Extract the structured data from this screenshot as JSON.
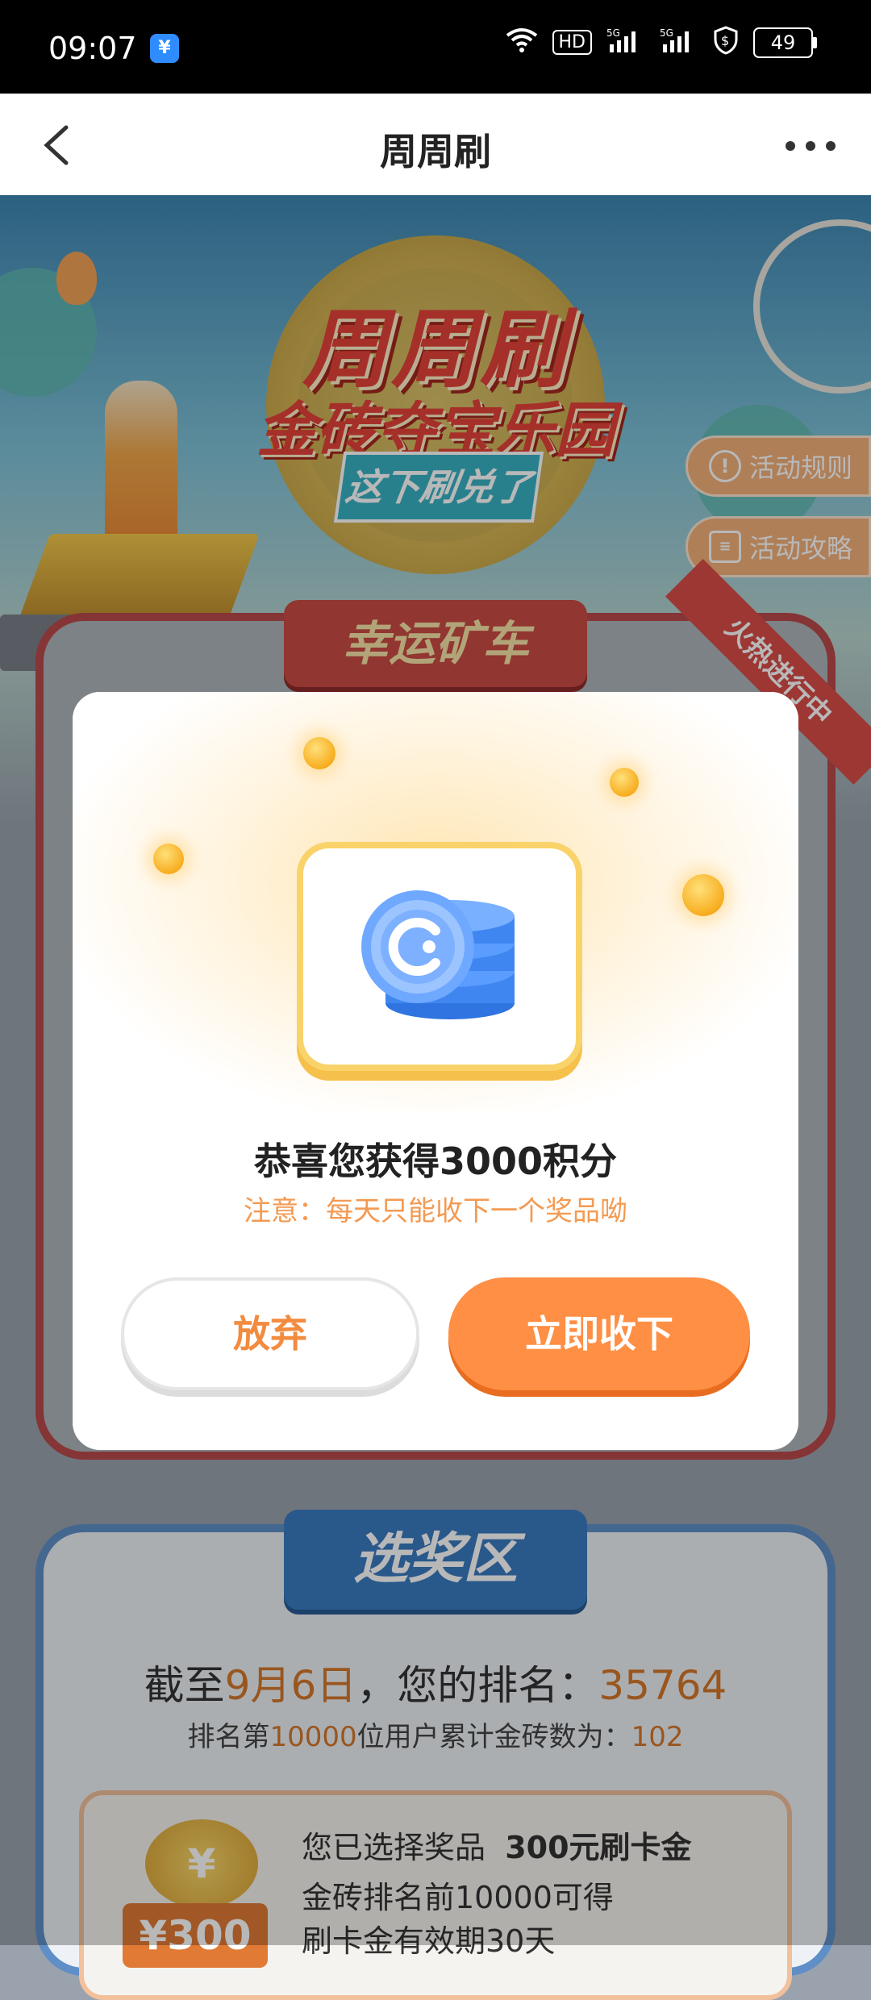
{
  "status_bar": {
    "time": "09:07",
    "network": "HD 5G 5G",
    "hd_label": "HD",
    "battery": "49"
  },
  "nav": {
    "title": "周周刷"
  },
  "banner": {
    "title": "周周刷",
    "subtitle": "金砖夺宝乐园",
    "tag": "这下刷兑了"
  },
  "side_buttons": {
    "rules": "活动规则",
    "guide": "活动攻略"
  },
  "mine_section": {
    "label": "幸运矿车",
    "ribbon": "火热进行中"
  },
  "dialog": {
    "title": "恭喜您获得3000积分",
    "note": "注意：每天只能收下一个奖品呦",
    "giveup_label": "放弃",
    "accept_label": "立即收下"
  },
  "prize_section": {
    "label": "选奖区",
    "rank_prefix": "截至",
    "rank_date": "9月6日",
    "rank_middle": "，您的排名：",
    "rank_value": "35764",
    "threshold_prefix": "排名第",
    "threshold_rank": "10000",
    "threshold_middle": "位用户累计金砖数为：",
    "threshold_value": "102",
    "selected_prefix": "您已选择奖品",
    "selected_prize": "300元刷卡金",
    "line2": "金砖排名前10000可得",
    "line3": "刷卡金有效期30天",
    "coin_symbol": "¥",
    "ribbon_amount": "¥300"
  },
  "colors": {
    "accent_orange": "#ff8f44",
    "highlight_orange": "#d4782c",
    "mine_red": "#c94b43",
    "prize_blue": "#3a7ac1"
  }
}
